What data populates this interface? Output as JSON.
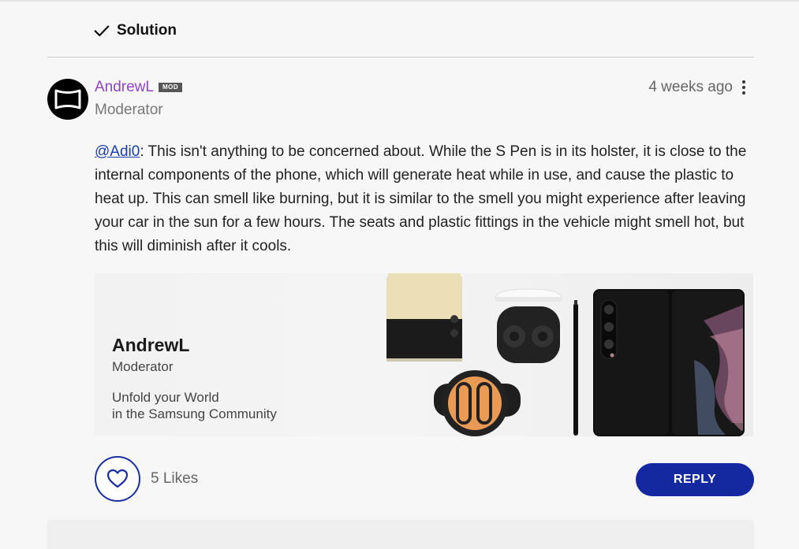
{
  "solution": {
    "label": "Solution",
    "icon": "check-icon"
  },
  "post": {
    "author": {
      "name": "AndrewL",
      "badge": "MOD",
      "role": "Moderator",
      "name_color": "#8e44c7"
    },
    "timestamp": "4 weeks ago",
    "mention": "@Adi0",
    "body": ": This isn't anything to be concerned about. While the S Pen is in its holster, it is close to the internal components of the phone, which will generate heat while in use, and cause the plastic to heat up. This can smell like burning, but it is similar to the smell you might experience after leaving your car in the sun for a few hours. The seats and plastic fittings in the vehicle might smell hot, but this will diminish after it cools."
  },
  "banner": {
    "name": "AndrewL",
    "role": "Moderator",
    "tagline_line1": "Unfold your World",
    "tagline_line2": "in the Samsung Community"
  },
  "actions": {
    "likes": "5 Likes",
    "reply": "REPLY",
    "accent_color": "#1428a0"
  }
}
